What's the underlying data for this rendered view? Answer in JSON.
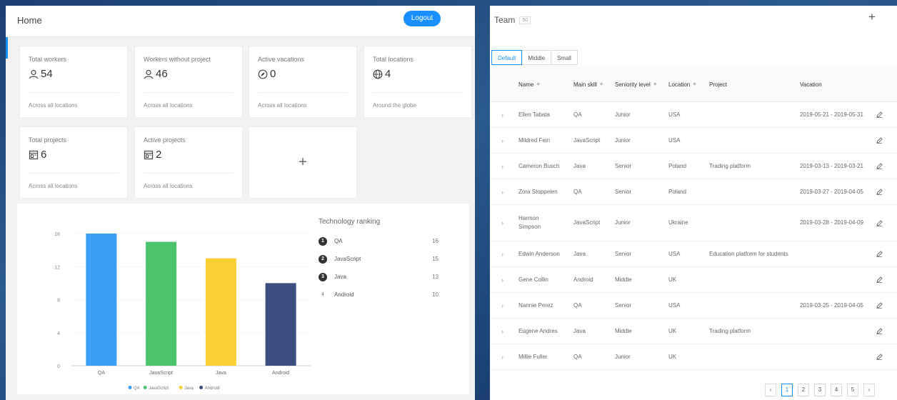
{
  "home": {
    "title": "Home",
    "logout_label": "Logout",
    "stats": [
      {
        "title": "Total workers",
        "icon": "user-icon",
        "value": "54",
        "footer": "Across all locations"
      },
      {
        "title": "Workers without project",
        "icon": "user-icon",
        "value": "46",
        "footer": "Across all locations"
      },
      {
        "title": "Active vacations",
        "icon": "compass-icon",
        "value": "0",
        "footer": "Across all locations"
      },
      {
        "title": "Total locations",
        "icon": "globe-icon",
        "value": "4",
        "footer": "Around the globe"
      },
      {
        "title": "Total projects",
        "icon": "project-icon",
        "value": "6",
        "footer": "Across all locations"
      },
      {
        "title": "Active projects",
        "icon": "project-icon",
        "value": "2",
        "footer": "Across all locations"
      }
    ],
    "add_card_symbol": "+"
  },
  "chart_data": {
    "type": "bar",
    "categories": [
      "QA",
      "JavaScript",
      "Java",
      "Android"
    ],
    "values": [
      16,
      15,
      13,
      10
    ],
    "colors": [
      "#3aa0f5",
      "#4cc46e",
      "#fad035",
      "#3e4d82"
    ],
    "ylim": [
      0,
      16
    ],
    "yticks": [
      0,
      4,
      8,
      12,
      16
    ],
    "legend": [
      "QA",
      "JavaScript",
      "Java",
      "Android"
    ],
    "legend_position": "bottom",
    "grid": true
  },
  "ranking": {
    "title": "Technology ranking",
    "items": [
      {
        "rank": "1",
        "name": "QA",
        "count": "16"
      },
      {
        "rank": "2",
        "name": "JavaScript",
        "count": "15"
      },
      {
        "rank": "3",
        "name": "Java",
        "count": "13"
      },
      {
        "rank": "4",
        "name": "Android",
        "count": "10"
      }
    ]
  },
  "team": {
    "title": "Team",
    "badge": "50",
    "add_symbol": "+",
    "size_tabs": [
      "Default",
      "Middle",
      "Small"
    ],
    "active_tab": "Default",
    "columns": [
      "Name",
      "Main skill",
      "Seniority level",
      "Location",
      "Project",
      "Vacation"
    ],
    "rows": [
      {
        "name": "Ellen Tabata",
        "skill": "QA",
        "level": "Junior",
        "location": "USA",
        "project": "",
        "vacation": "2019-05-21 - 2019-05-31"
      },
      {
        "name": "Mildred Fein",
        "skill": "JavaScript",
        "level": "Junior",
        "location": "USA",
        "project": "",
        "vacation": ""
      },
      {
        "name": "Cameron Busch",
        "skill": "Java",
        "level": "Senior",
        "location": "Poland",
        "project": "Trading platform",
        "vacation": "2019-03-13 - 2019-03-21"
      },
      {
        "name": "Zora Stoppelen",
        "skill": "QA",
        "level": "Senior",
        "location": "Poland",
        "project": "",
        "vacation": "2019-03-27 - 2019-04-05"
      },
      {
        "name": "Harmon Simpson",
        "skill": "JavaScript",
        "level": "Junior",
        "location": "Ukraine",
        "project": "",
        "vacation": "2019-03-28 - 2019-04-09"
      },
      {
        "name": "Edwin Anderson",
        "skill": "Java",
        "level": "Senior",
        "location": "USA",
        "project": "Education platform for students",
        "vacation": ""
      },
      {
        "name": "Gene Collin",
        "skill": "Android",
        "level": "Middle",
        "location": "UK",
        "project": "",
        "vacation": ""
      },
      {
        "name": "Nannie Perez",
        "skill": "QA",
        "level": "Senior",
        "location": "USA",
        "project": "",
        "vacation": "2019-03-25 - 2019-04-05"
      },
      {
        "name": "Eugene Andres",
        "skill": "Java",
        "level": "Middle",
        "location": "UK",
        "project": "Trading platform",
        "vacation": ""
      },
      {
        "name": "Millie Fuller",
        "skill": "QA",
        "level": "Junior",
        "location": "UK",
        "project": "",
        "vacation": ""
      }
    ],
    "pagination": {
      "prev": "‹",
      "pages": [
        "1",
        "2",
        "3",
        "4",
        "5"
      ],
      "next": "›",
      "current": "1"
    }
  }
}
